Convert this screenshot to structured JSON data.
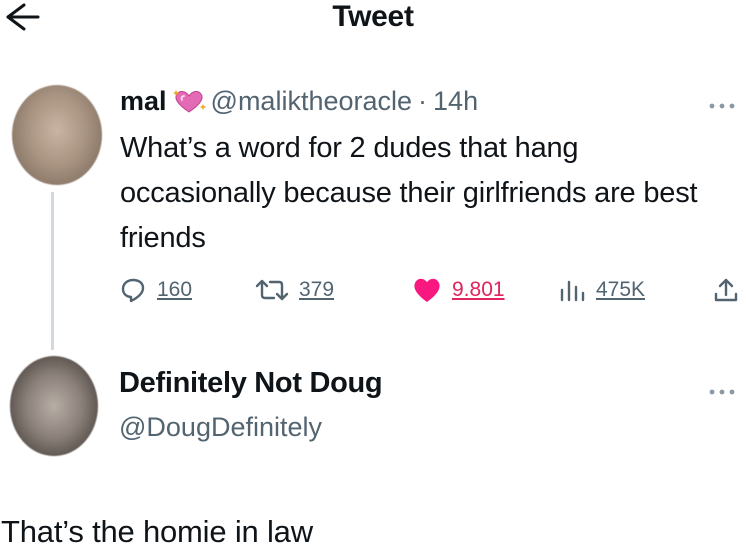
{
  "header": {
    "title": "Tweet",
    "back_icon": "arrow-left-icon"
  },
  "tweet": {
    "author_name": "mal",
    "author_emoji": "sparkling-heart-icon",
    "author_handle": "@maliktheoracle",
    "separator": "·",
    "time": "14h",
    "text": "What’s a word for 2 dudes that hang occasionally because their girlfriends are best friends",
    "actions": {
      "replies": "160",
      "retweets": "379",
      "likes": "9.801",
      "views": "475K"
    },
    "like_color": "#f91880"
  },
  "reply": {
    "author_name": "Definitely Not Doug",
    "author_handle": "@DougDefinitely",
    "text": "That’s the homie in law"
  },
  "colors": {
    "text": "#0f1419",
    "muted": "#536471",
    "like": "#f91880",
    "thread_line": "#cfd9de"
  }
}
